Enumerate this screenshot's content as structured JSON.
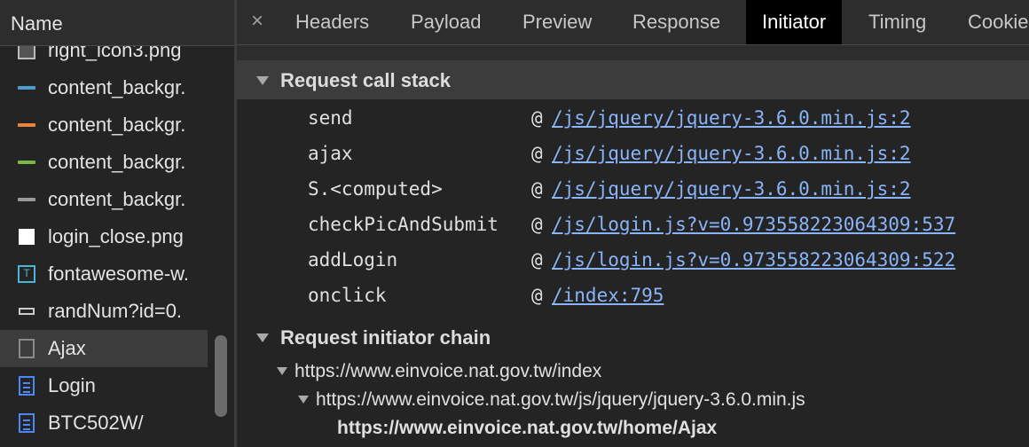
{
  "name_panel": {
    "header": "Name",
    "files": [
      {
        "name": "right_icon3.png",
        "icon": "image-file-icon"
      },
      {
        "name": "content_backgr.",
        "icon": "blue-bar-image-icon",
        "color": "#4a9ec7"
      },
      {
        "name": "content_backgr.",
        "icon": "orange-bar-image-icon",
        "color": "#e8853a"
      },
      {
        "name": "content_backgr.",
        "icon": "green-bar-image-icon",
        "color": "#7ab648"
      },
      {
        "name": "content_backgr.",
        "icon": "gray-bar-image-icon",
        "color": "#9a9a9a"
      },
      {
        "name": "login_close.png",
        "icon": "white-image-icon"
      },
      {
        "name": "fontawesome-w.",
        "icon": "font-file-icon",
        "glyph": "T"
      },
      {
        "name": "randNum?id=0.",
        "icon": "small-image-icon"
      },
      {
        "name": "Ajax",
        "icon": "xhr-document-icon",
        "selected": true
      },
      {
        "name": "Login",
        "icon": "html-document-icon"
      },
      {
        "name": "BTC502W/",
        "icon": "html-document-icon"
      }
    ]
  },
  "tabs": {
    "close_glyph": "×",
    "items": [
      "Headers",
      "Payload",
      "Preview",
      "Response",
      "Initiator",
      "Timing",
      "Cookie"
    ],
    "active": "Initiator"
  },
  "call_stack": {
    "title": "Request call stack",
    "at_symbol": "@",
    "frames": [
      {
        "function": "send",
        "location": "/js/jquery/jquery-3.6.0.min.js:2"
      },
      {
        "function": "ajax",
        "location": "/js/jquery/jquery-3.6.0.min.js:2"
      },
      {
        "function": "S.<computed>",
        "location": "/js/jquery/jquery-3.6.0.min.js:2"
      },
      {
        "function": "checkPicAndSubmit",
        "location": "/js/login.js?v=0.973558223064309:537"
      },
      {
        "function": "addLogin",
        "location": "/js/login.js?v=0.973558223064309:522"
      },
      {
        "function": "onclick",
        "location": "/index:795"
      }
    ]
  },
  "initiator_chain": {
    "title": "Request initiator chain",
    "items": [
      "https://www.einvoice.nat.gov.tw/index",
      "https://www.einvoice.nat.gov.tw/js/jquery/jquery-3.6.0.min.js",
      "https://www.einvoice.nat.gov.tw/home/Ajax"
    ]
  },
  "colors": {
    "link": "#8ab4f8",
    "background": "#242424",
    "section_header": "#3c3c3c",
    "active_tab": "#000000"
  }
}
